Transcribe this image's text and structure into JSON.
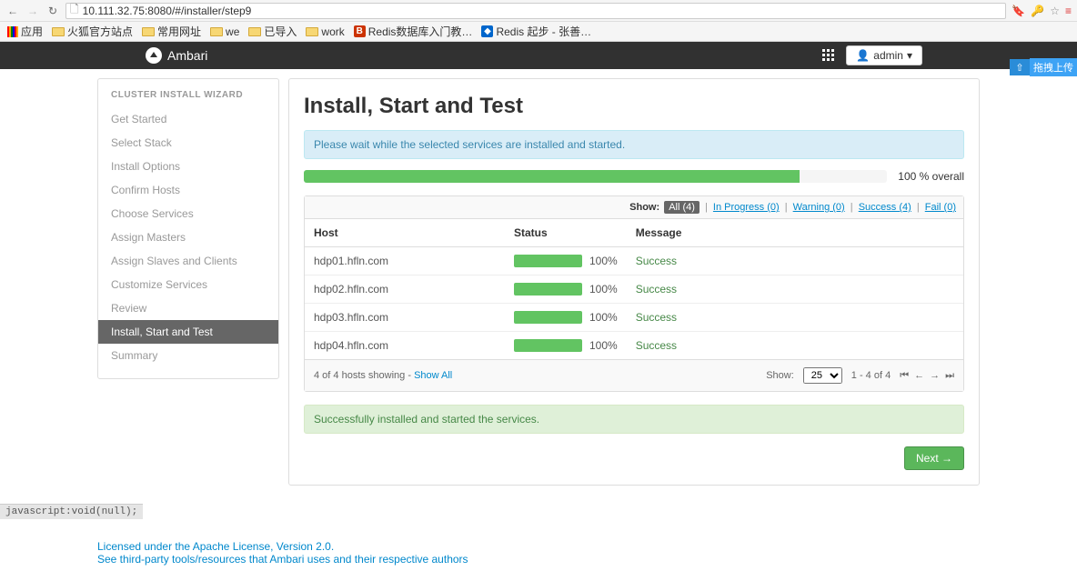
{
  "browser": {
    "url": "10.111.32.75:8080/#/installer/step9",
    "status_text": "javascript:void(null);"
  },
  "bookmarks": {
    "apps": "应用",
    "items": [
      "火狐官方站点",
      "常用网址",
      "we",
      "已导入",
      "work",
      "Redis数据库入门教…",
      "Redis 起步 - 张善…"
    ]
  },
  "topnav": {
    "brand": "Ambari",
    "admin": "admin"
  },
  "float": {
    "label": "拖拽上传"
  },
  "sidebar": {
    "title": "CLUSTER INSTALL WIZARD",
    "steps": [
      {
        "label": "Get Started",
        "active": false
      },
      {
        "label": "Select Stack",
        "active": false
      },
      {
        "label": "Install Options",
        "active": false
      },
      {
        "label": "Confirm Hosts",
        "active": false
      },
      {
        "label": "Choose Services",
        "active": false
      },
      {
        "label": "Assign Masters",
        "active": false
      },
      {
        "label": "Assign Slaves and Clients",
        "active": false
      },
      {
        "label": "Customize Services",
        "active": false
      },
      {
        "label": "Review",
        "active": false
      },
      {
        "label": "Install, Start and Test",
        "active": true
      },
      {
        "label": "Summary",
        "active": false
      }
    ]
  },
  "page": {
    "title": "Install, Start and Test",
    "wait_msg": "Please wait while the selected services are installed and started.",
    "overall_pct": "100 % overall",
    "filters": {
      "show": "Show:",
      "all": "All (4)",
      "inprog": "In Progress (0)",
      "warning": "Warning (0)",
      "success": "Success (4)",
      "fail": "Fail (0)"
    },
    "headers": {
      "host": "Host",
      "status": "Status",
      "message": "Message"
    },
    "rows": [
      {
        "host": "hdp01.hfln.com",
        "pct": "100%",
        "msg": "Success"
      },
      {
        "host": "hdp02.hfln.com",
        "pct": "100%",
        "msg": "Success"
      },
      {
        "host": "hdp03.hfln.com",
        "pct": "100%",
        "msg": "Success"
      },
      {
        "host": "hdp04.hfln.com",
        "pct": "100%",
        "msg": "Success"
      }
    ],
    "footer": {
      "left_a": "4 of 4 hosts showing - ",
      "left_b": "Show All",
      "show_lbl": "Show:",
      "per_page": "25",
      "range": "1 - 4 of 4"
    },
    "result": "Successfully installed and started the services.",
    "next": "Next →"
  },
  "license": {
    "line1": "Licensed under the Apache License, Version 2.0.",
    "line2": "See third-party tools/resources that Ambari uses and their respective authors"
  }
}
